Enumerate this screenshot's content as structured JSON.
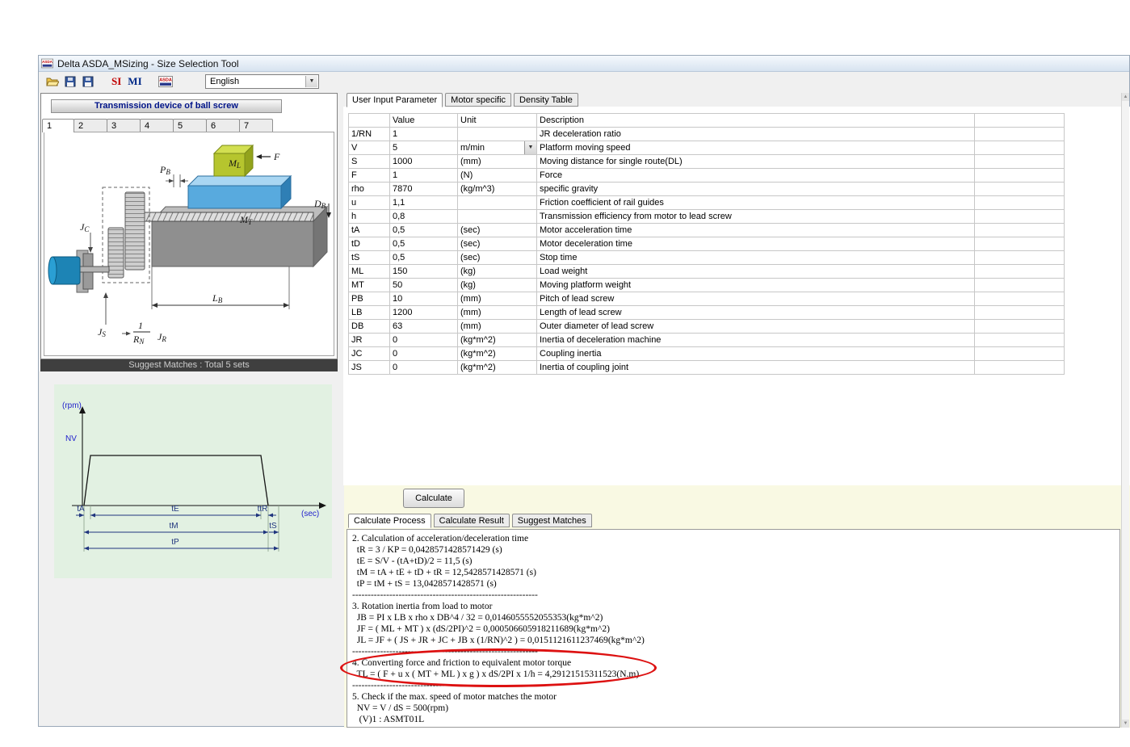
{
  "window": {
    "title": "Delta ASDA_MSizing - Size Selection Tool"
  },
  "toolbar": {
    "icons": [
      "asda-logo-icon",
      "open-folder-icon",
      "save-icon",
      "save-as-icon",
      "asda-logo-icon"
    ],
    "asda_logo_text": "ASDA",
    "si": "SI",
    "mi": "MI",
    "language": "English"
  },
  "colors": {
    "chart_bg": "#e2f1e2",
    "calc_panel_bg": "#f9f9e3",
    "annotation_red": "#dd1111",
    "suggest_bar_bg": "#3f3f3f",
    "header_text": "#001489"
  },
  "left_panel": {
    "header": "Transmission device of ball screw",
    "tabs": [
      "1",
      "2",
      "3",
      "4",
      "5",
      "6",
      "7"
    ],
    "active_tab": "1",
    "suggest_bar": "Suggest Matches : Total  5 sets",
    "diagram": {
      "pb_main": "P",
      "pb_sub": "B",
      "ml_main": "M",
      "ml_sub": "L",
      "f": "F",
      "db_main": "D",
      "db_sub": "B",
      "mt_main": "M",
      "mt_sub": "T",
      "jc_main": "J",
      "jc_sub": "C",
      "lb_main": "L",
      "lb_sub": "B",
      "js_main": "J",
      "js_sub": "S",
      "jr_main": "J",
      "jr_sub": "R",
      "ratio_num": "1",
      "ratio_den_main": "R",
      "ratio_den_sub": "N"
    },
    "profile_chart": {
      "type": "line",
      "y_axis_label": "(rpm)",
      "x_axis_label": "(sec)",
      "speed_level": "NV",
      "t_accel": "tA",
      "t_constant": "tE",
      "t_decel_rest": "ttR",
      "t_move": "tM",
      "t_stop": "tS",
      "t_period": "tP"
    }
  },
  "right_panel": {
    "tabs": [
      "User Input Parameter",
      "Motor specific",
      "Density Table"
    ],
    "active_tab": "User Input Parameter",
    "table": {
      "headers": [
        "",
        "Value",
        "Unit",
        "Description",
        ""
      ],
      "rows": [
        {
          "param": "1/RN",
          "value": "1",
          "unit": "",
          "description": "JR deceleration ratio"
        },
        {
          "param": "V",
          "value": "5",
          "unit": "m/min",
          "description": "Platform moving speed",
          "unit_dropdown": true
        },
        {
          "param": "S",
          "value": "1000",
          "unit": "(mm)",
          "description": "Moving distance for single route(DL)"
        },
        {
          "param": "F",
          "value": "1",
          "unit": "(N)",
          "description": "Force"
        },
        {
          "param": "rho",
          "value": "7870",
          "unit": "(kg/m^3)",
          "description": "specific gravity"
        },
        {
          "param": "u",
          "value": "1,1",
          "unit": "",
          "description": "Friction coefficient of rail guides"
        },
        {
          "param": "h",
          "value": "0,8",
          "unit": "",
          "description": "Transmission efficiency from motor to lead screw"
        },
        {
          "param": "tA",
          "value": "0,5",
          "unit": "(sec)",
          "description": "Motor acceleration time"
        },
        {
          "param": "tD",
          "value": "0,5",
          "unit": "(sec)",
          "description": "Motor deceleration time"
        },
        {
          "param": "tS",
          "value": "0,5",
          "unit": "(sec)",
          "description": "Stop time"
        },
        {
          "param": "ML",
          "value": "150",
          "unit": "(kg)",
          "description": "Load weight"
        },
        {
          "param": "MT",
          "value": "50",
          "unit": "(kg)",
          "description": "Moving platform weight"
        },
        {
          "param": "PB",
          "value": "10",
          "unit": "(mm)",
          "description": "Pitch of lead screw"
        },
        {
          "param": "LB",
          "value": "1200",
          "unit": "(mm)",
          "description": "Length of lead screw"
        },
        {
          "param": "DB",
          "value": "63",
          "unit": "(mm)",
          "description": "Outer diameter of lead screw"
        },
        {
          "param": "JR",
          "value": "0",
          "unit": "(kg*m^2)",
          "description": "Inertia of deceleration machine"
        },
        {
          "param": "JC",
          "value": "0",
          "unit": "(kg*m^2)",
          "description": "Coupling inertia"
        },
        {
          "param": "JS",
          "value": "0",
          "unit": "(kg*m^2)",
          "description": "Inertia of coupling joint"
        }
      ]
    }
  },
  "calc_section": {
    "calculate_button": "Calculate",
    "tabs": [
      "Calculate Process",
      "Calculate Result",
      "Suggest Matches"
    ],
    "active_tab": "Calculate Process",
    "output_lines": [
      "2. Calculation of acceleration/deceleration time",
      "  tR = 3 / KP = 0,0428571428571429 (s)",
      "  tE = S/V - (tA+tD)/2 = 11,5 (s)",
      "  tM = tA + tE + tD + tR = 12,5428571428571 (s)",
      "  tP = tM + tS = 13,0428571428571 (s)",
      "------------------------------------------------------------",
      "3. Rotation inertia from load to motor",
      "  JB = PI x LB x rho x DB^4 / 32 = 0,0146055552055353(kg*m^2)",
      "  JF = ( ML + MT ) x (dS/2PI)^2 = 0,000506605918211689(kg*m^2)",
      "  JL = JF + ( JS + JR + JC + JB x (1/RN)^2 ) = 0,0151121611237469(kg*m^2)",
      "------------------------------------------------------------",
      "4. Converting force and friction to equivalent motor torque",
      "  TL = ( F + u x ( MT + ML ) x g ) x dS/2PI x 1/h = 4,29121515311523(N.m)",
      "------------------------------------------------------------",
      "5. Check if the max. speed of motor matches the motor",
      "  NV = V / dS = 500(rpm)",
      "   (V)1 : ASMT01L"
    ]
  }
}
